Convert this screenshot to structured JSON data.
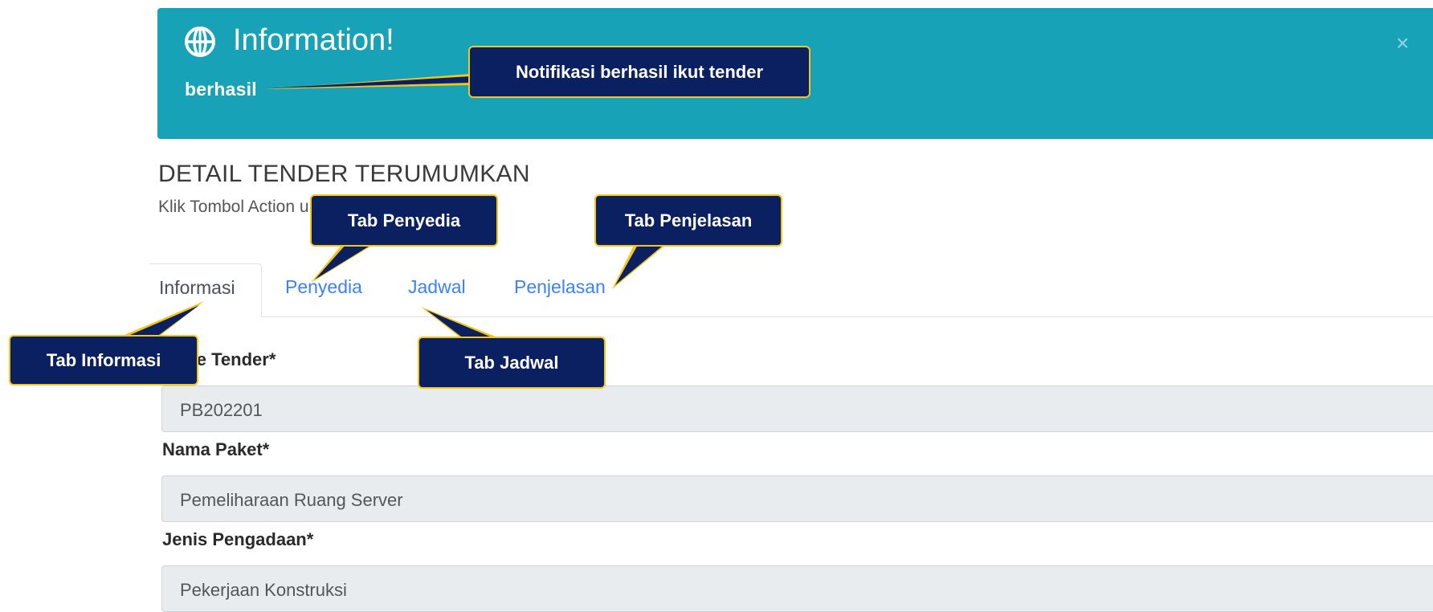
{
  "alert": {
    "title": "Information!",
    "message": "berhasil",
    "close": "×",
    "icon": "globe-icon",
    "color": "#17a2b8"
  },
  "page": {
    "title": "DETAIL TENDER TERUMUMKAN",
    "subtitle": "Klik Tombol Action untuk Lebih Lanjut"
  },
  "tabs": [
    {
      "label": "Informasi",
      "active": true
    },
    {
      "label": "Penyedia",
      "active": false
    },
    {
      "label": "Jadwal",
      "active": false
    },
    {
      "label": "Penjelasan",
      "active": false
    }
  ],
  "fields": [
    {
      "label": "Kode Tender*",
      "value": "PB202201"
    },
    {
      "label": "Nama Paket*",
      "value": "Pemeliharaan Ruang Server"
    },
    {
      "label": "Jenis Pengadaan*",
      "value": "Pekerjaan Konstruksi"
    }
  ],
  "callouts": {
    "notif": "Notifikasi berhasil ikut tender",
    "penyedia": "Tab Penyedia",
    "penjelasan": "Tab Penjelasan",
    "informasi": "Tab Informasi",
    "jadwal": "Tab Jadwal",
    "fill_color": "#0a2060",
    "border_color": "#f5c518"
  }
}
